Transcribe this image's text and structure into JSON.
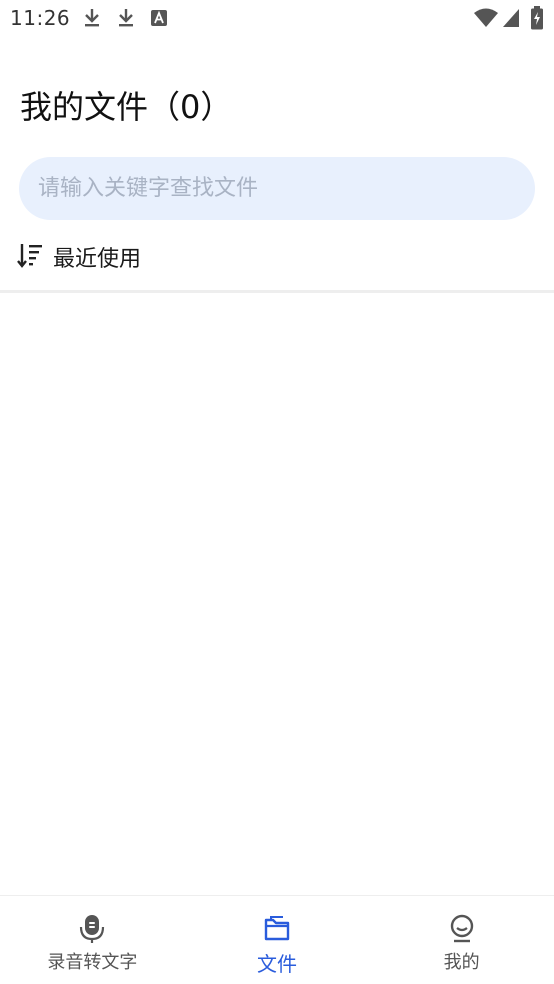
{
  "status_bar": {
    "time": "11:26",
    "icons": [
      "download-icon",
      "download-icon",
      "keyboard-a-icon",
      "wifi-icon",
      "signal-icon",
      "battery-charging-icon"
    ]
  },
  "header": {
    "title": "我的文件（0）"
  },
  "search": {
    "placeholder": "请输入关键字查找文件",
    "value": ""
  },
  "sort": {
    "icon": "sort-descending-icon",
    "label": "最近使用"
  },
  "bottom_nav": {
    "items": [
      {
        "label": "录音转文字",
        "icon": "microphone-icon",
        "active": false
      },
      {
        "label": "文件",
        "icon": "folder-icon",
        "active": true
      },
      {
        "label": "我的",
        "icon": "profile-icon",
        "active": false
      }
    ]
  },
  "colors": {
    "accent": "#2a5cdc",
    "search_bg": "#e8f0fd",
    "placeholder": "#a9b3c4",
    "inactive_nav": "#555555"
  }
}
